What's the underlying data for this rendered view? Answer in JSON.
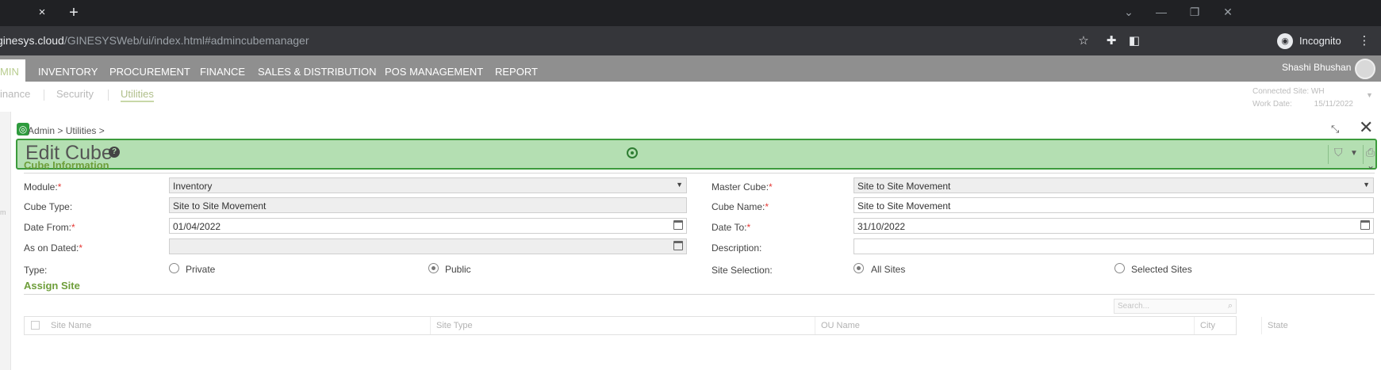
{
  "browser": {
    "tab_close": "×",
    "tab_new": "+",
    "url_host": "ginesys.cloud",
    "url_path": "/GINESYSWeb/ui/index.html#admincubemanager",
    "incognito_label": "Incognito"
  },
  "topmenu": {
    "items": [
      "MIN",
      "INVENTORY",
      "PROCUREMENT",
      "FINANCE",
      "SALES & DISTRIBUTION",
      "POS MANAGEMENT",
      "REPORT"
    ],
    "user_name": "Shashi Bhushan"
  },
  "submenu": {
    "items": [
      "inance",
      "Security",
      "Utilities"
    ],
    "connected_site": "Connected Site: WH",
    "work_date_label": "Work Date:",
    "work_date": "15/11/2022"
  },
  "dialog": {
    "breadcrumb": "Admin > Utilities >",
    "title": "Edit Cube",
    "section_cube_info": "Cube Information",
    "section_assign_site": "Assign Site"
  },
  "form": {
    "module_label": "Module:",
    "module_value": "Inventory",
    "cube_type_label": "Cube Type:",
    "cube_type_value": "Site to Site Movement",
    "date_from_label": "Date From:",
    "date_from_value": "01/04/2022",
    "as_on_dated_label": "As on Dated:",
    "as_on_dated_value": "",
    "type_label": "Type:",
    "type_private": "Private",
    "type_public": "Public",
    "master_cube_label": "Master Cube:",
    "master_cube_value": "Site to Site Movement",
    "cube_name_label": "Cube Name:",
    "cube_name_value": "Site to Site Movement",
    "date_to_label": "Date To:",
    "date_to_value": "31/10/2022",
    "description_label": "Description:",
    "description_value": "",
    "site_selection_label": "Site Selection:",
    "site_all": "All Sites",
    "site_selected": "Selected Sites",
    "type_selected": "Public",
    "site_selection_selected": "All Sites"
  },
  "assign_site": {
    "search_placeholder": "Search...",
    "columns": [
      "Site Name",
      "Site Type",
      "OU Name",
      "City",
      "State"
    ]
  },
  "colors": {
    "title_bar_bg": "#b4dfb2",
    "title_bar_border": "#3c9b3c",
    "section_title": "#6e9e3a",
    "required": "#e53935"
  }
}
